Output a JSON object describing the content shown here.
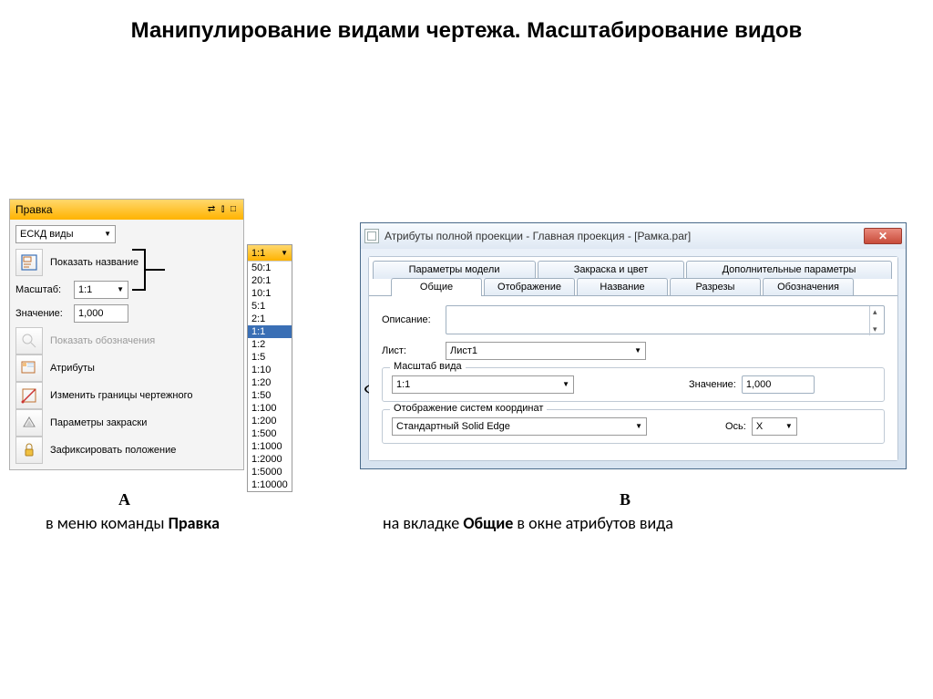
{
  "page_title": "Манипулирование видами чертежа. Масштабирование видов",
  "panel_a": {
    "title": "Правка",
    "controls_glyphs": "⇄ ⫾ □",
    "mode_dropdown": "ЕСКД виды",
    "show_name_label": "Показать название",
    "scale_label": "Масштаб:",
    "scale_value": "1:1",
    "value_label": "Значение:",
    "value_text": "1,000",
    "show_designations": "Показать обозначения",
    "attributes": "Атрибуты",
    "change_bounds": "Изменить границы чертежного",
    "fill_params": "Параметры закраски",
    "fix_position": "Зафиксировать положение"
  },
  "scale_list": {
    "current": "1:1",
    "items": [
      "50:1",
      "20:1",
      "10:1",
      "5:1",
      "2:1",
      "1:1",
      "1:2",
      "1:5",
      "1:10",
      "1:20",
      "1:50",
      "1:100",
      "1:200",
      "1:500",
      "1:1000",
      "1:2000",
      "1:5000",
      "1:10000"
    ],
    "selected_index": 5
  },
  "panel_b": {
    "title": "Атрибуты полной проекции - Главная проекция - [Рамка.par]",
    "tabs_top": [
      "Параметры модели",
      "Закраска и цвет",
      "Дополнительные параметры"
    ],
    "tabs_second": [
      "Общие",
      "Отображение",
      "Название",
      "Разрезы",
      "Обозначения"
    ],
    "active_tab": "Общие",
    "desc_label": "Описание:",
    "sheet_label": "Лист:",
    "sheet_value": "Лист1",
    "scale_legend": "Масштаб вида",
    "scale_value": "1:1",
    "value_label": "Значение:",
    "value_text": "1,000",
    "coord_legend": "Отображение систем координат",
    "coord_value": "Стандартный Solid Edge",
    "axis_label": "Ось:",
    "axis_value": "X",
    "close_glyph": "✕"
  },
  "letters": {
    "a": "A",
    "b": "B"
  },
  "captions": {
    "a_pre": "в меню команды ",
    "a_bold": "Правка",
    "b_pre": "на вкладке ",
    "b_bold": "Общие",
    "b_post": " в окне атрибутов вида"
  }
}
